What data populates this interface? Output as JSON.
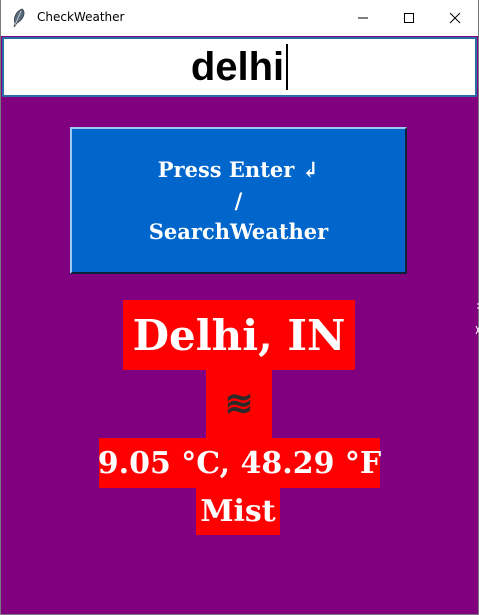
{
  "window": {
    "title": "CheckWeather",
    "icon": "feather-icon",
    "controls": {
      "minimize_icon": "minimize-icon",
      "maximize_icon": "maximize-icon",
      "close_icon": "close-icon"
    }
  },
  "search": {
    "value": "delhi"
  },
  "search_button": {
    "line1": "Press Enter ↲",
    "line2": "/",
    "line3": "SearchWeather"
  },
  "result": {
    "location": "Delhi, IN",
    "condition_icon": "mist-icon",
    "condition_glyph": "≋",
    "temperature": "9.05 °C, 48.29 °F",
    "description": "Mist"
  },
  "colors": {
    "background": "#800080",
    "button": "#0066cc",
    "result_background": "#ff0000",
    "text": "#ffffff"
  }
}
